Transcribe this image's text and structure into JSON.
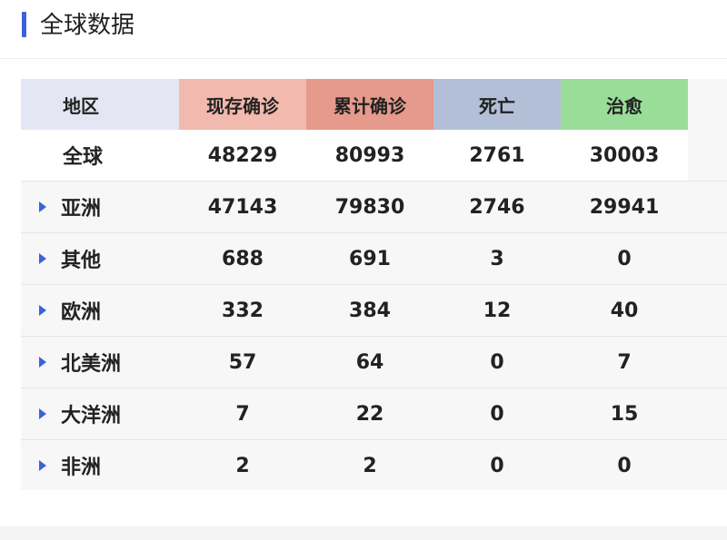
{
  "page": {
    "title": "全球数据",
    "accent_color": "#3b63d9"
  },
  "table": {
    "headers": [
      {
        "label": "地区",
        "color": "#e4e6f3"
      },
      {
        "label": "现存确诊",
        "color": "#f2b9ae"
      },
      {
        "label": "累计确诊",
        "color": "#e69a8b"
      },
      {
        "label": "死亡",
        "color": "#b3bfd6"
      },
      {
        "label": "治愈",
        "color": "#99dd99"
      }
    ],
    "global": {
      "name": "全球",
      "values": [
        "48229",
        "80993",
        "2761",
        "30003"
      ]
    },
    "rows": [
      {
        "name": "亚洲",
        "values": [
          "47143",
          "79830",
          "2746",
          "29941"
        ]
      },
      {
        "name": "其他",
        "values": [
          "688",
          "691",
          "3",
          "0"
        ]
      },
      {
        "name": "欧洲",
        "values": [
          "332",
          "384",
          "12",
          "40"
        ]
      },
      {
        "name": "北美洲",
        "values": [
          "57",
          "64",
          "0",
          "7"
        ]
      },
      {
        "name": "大洋洲",
        "values": [
          "7",
          "22",
          "0",
          "15"
        ]
      },
      {
        "name": "非洲",
        "values": [
          "2",
          "2",
          "0",
          "0"
        ]
      }
    ],
    "caret_icon": "caret-right-icon"
  }
}
